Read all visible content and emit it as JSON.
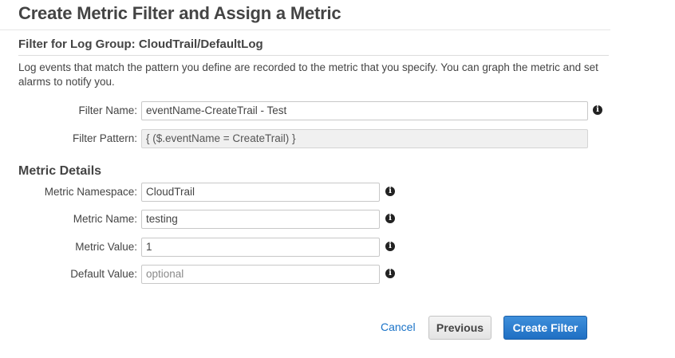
{
  "page": {
    "title": "Create Metric Filter and Assign a Metric",
    "subtitle": "Filter for Log Group: CloudTrail/DefaultLog",
    "description": "Log events that match the pattern you define are recorded to the metric that you specify. You can graph the metric and set alarms to notify you."
  },
  "filter": {
    "name_label": "Filter Name:",
    "name_value": "eventName-CreateTrail - Test",
    "pattern_label": "Filter Pattern:",
    "pattern_value": "{ ($.eventName = CreateTrail) }"
  },
  "metric_details": {
    "heading": "Metric Details",
    "namespace_label": "Metric Namespace:",
    "namespace_value": "CloudTrail",
    "name_label": "Metric Name:",
    "name_value": "testing",
    "value_label": "Metric Value:",
    "value_value": "1",
    "default_label": "Default Value:",
    "default_placeholder": "optional"
  },
  "actions": {
    "cancel_label": "Cancel",
    "previous_label": "Previous",
    "create_label": "Create Filter"
  },
  "icons": {
    "info": "info-icon"
  },
  "colors": {
    "primary_button": "#1f6fc3",
    "link": "#1a73c8",
    "disabled_field": "#f0f0f0"
  }
}
